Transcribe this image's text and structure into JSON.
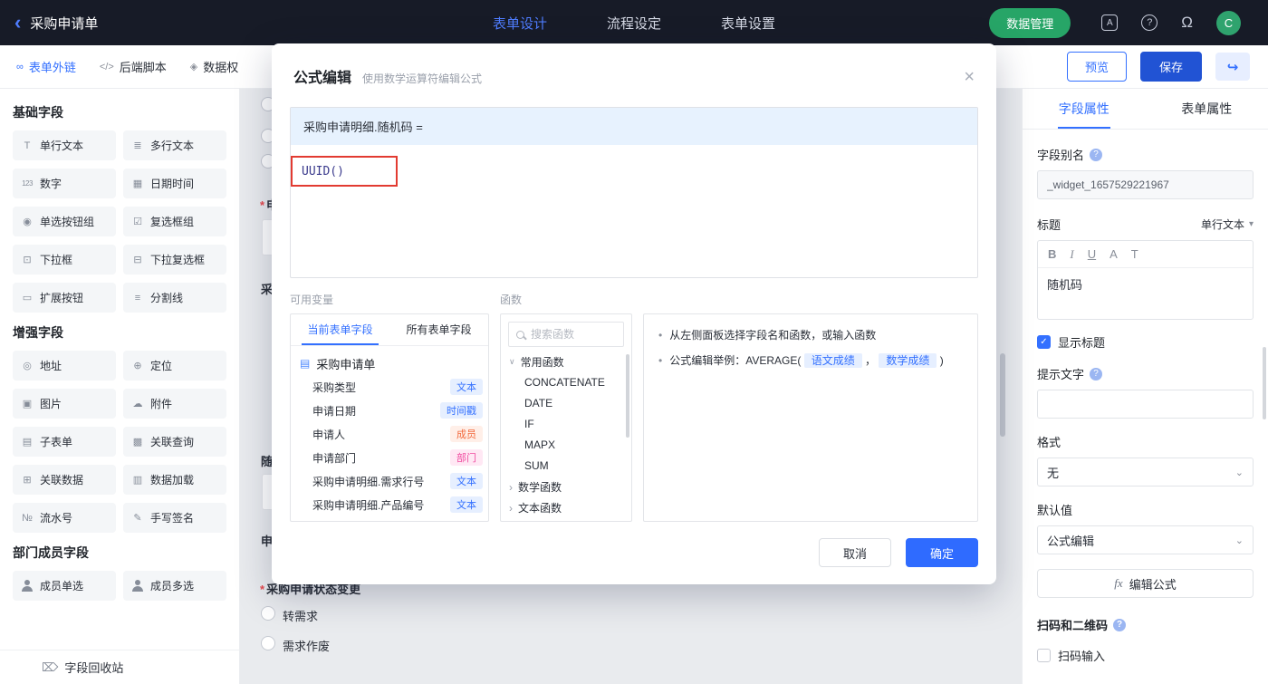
{
  "topbar": {
    "back_icon": "‹",
    "title": "采购申请单",
    "tabs": [
      "表单设计",
      "流程设定",
      "表单设置"
    ],
    "data_manage": "数据管理",
    "app_icon": "A",
    "help_icon": "?",
    "bell_icon": "Ω",
    "avatar": "C"
  },
  "toolbar": {
    "links": [
      {
        "label": "表单外链",
        "icon": "∞"
      },
      {
        "label": "后端脚本",
        "icon": "</>"
      },
      {
        "label": "数据权",
        "icon": "◈"
      }
    ],
    "preview": "预览",
    "save": "保存",
    "share_icon": "↪"
  },
  "palette": {
    "sections": [
      "基础字段",
      "增强字段",
      "部门成员字段"
    ],
    "basic": [
      {
        "label": "单行文本",
        "icon": "T"
      },
      {
        "label": "多行文本",
        "icon": "≣"
      },
      {
        "label": "数字",
        "icon": "123"
      },
      {
        "label": "日期时间",
        "icon": "▦"
      },
      {
        "label": "单选按钮组",
        "icon": "◉"
      },
      {
        "label": "复选框组",
        "icon": "☑"
      },
      {
        "label": "下拉框",
        "icon": "⊡"
      },
      {
        "label": "下拉复选框",
        "icon": "⊟"
      },
      {
        "label": "扩展按钮",
        "icon": "▭"
      },
      {
        "label": "分割线",
        "icon": "≡"
      }
    ],
    "enhanced": [
      {
        "label": "地址",
        "icon": "◎"
      },
      {
        "label": "定位",
        "icon": "⊕"
      },
      {
        "label": "图片",
        "icon": "▣"
      },
      {
        "label": "附件",
        "icon": "☁"
      },
      {
        "label": "子表单",
        "icon": "▤"
      },
      {
        "label": "关联查询",
        "icon": "▩"
      },
      {
        "label": "关联数据",
        "icon": "⊞"
      },
      {
        "label": "数据加载",
        "icon": "▥"
      },
      {
        "label": "流水号",
        "icon": "№"
      },
      {
        "label": "手写签名",
        "icon": "✎"
      }
    ],
    "member": [
      {
        "label": "成员单选"
      },
      {
        "label": "成员多选"
      }
    ],
    "recycle": "字段回收站",
    "recycle_icon": "⌦"
  },
  "canvas": {
    "star": "*",
    "frag_a": "申",
    "frag_b": "采",
    "frag_c": "随",
    "frag_d": "申",
    "status": "采购申请状态变更",
    "opt1": "转需求",
    "opt2": "需求作废"
  },
  "modal": {
    "title": "公式编辑",
    "subtitle": "使用数学运算符编辑公式",
    "close_icon": "×",
    "target": "采购申请明细.随机码 =",
    "formula": "UUID()",
    "vars_label": "可用变量",
    "funcs_label": "函数",
    "tab_current": "当前表单字段",
    "tab_all": "所有表单字段",
    "doc_icon": "▤",
    "tree_root": "采购申请单",
    "vars": [
      {
        "name": "采购类型",
        "badge": "文本"
      },
      {
        "name": "申请日期",
        "badge": "时间戳"
      },
      {
        "name": "申请人",
        "badge": "成员"
      },
      {
        "name": "申请部门",
        "badge": "部门"
      },
      {
        "name": "采购申请明细.需求行号",
        "badge": "文本"
      },
      {
        "name": "采购申请明细.产品编号",
        "badge": "文本"
      }
    ],
    "search_placeholder": "搜索函数",
    "chev_down": "∨",
    "chev_right": "›",
    "group_common": "常用函数",
    "functions": [
      "CONCATENATE",
      "DATE",
      "IF",
      "MAPX",
      "SUM"
    ],
    "group_math": "数学函数",
    "group_text": "文本函数",
    "bullet": "•",
    "help1": "从左侧面板选择字段名和函数，或输入函数",
    "help2_prefix": "公式编辑举例：AVERAGE(",
    "help2_tag1": "语文成绩",
    "help2_sep": "，",
    "help2_tag2": "数学成绩",
    "help2_suffix": ")",
    "cancel": "取消",
    "ok": "确定"
  },
  "props": {
    "tabs": [
      "字段属性",
      "表单属性"
    ],
    "q_icon": "?",
    "alias_label": "字段别名",
    "alias_value": "_widget_1657529221967",
    "title_label": "标题",
    "widget_type": "单行文本",
    "caret": "▾",
    "toolbar": [
      "B",
      "I",
      "U",
      "A",
      "T"
    ],
    "title_value": "随机码",
    "check_icon": "✓",
    "show_title": "显示标题",
    "hint_label": "提示文字",
    "format_label": "格式",
    "format_value": "无",
    "chevron": "⌄",
    "default_label": "默认值",
    "default_value": "公式编辑",
    "fx_icon": "fx",
    "fx_label": "编辑公式",
    "qr_label": "扫码和二维码",
    "scan_label": "扫码输入"
  }
}
